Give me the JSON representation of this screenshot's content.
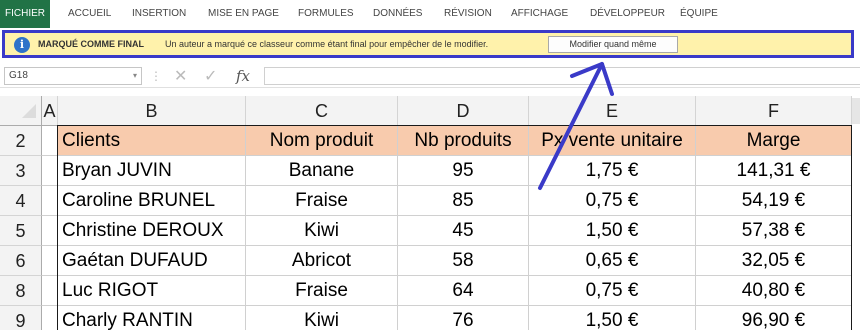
{
  "ribbon": {
    "tabs": [
      "FICHIER",
      "ACCUEIL",
      "INSERTION",
      "MISE EN PAGE",
      "FORMULES",
      "DONNÉES",
      "RÉVISION",
      "AFFICHAGE",
      "DÉVELOPPEUR",
      "ÉQUIPE"
    ]
  },
  "infobar": {
    "title": "MARQUÉ COMME FINAL",
    "message": "Un auteur a marqué ce classeur comme étant final pour empêcher de le modifier.",
    "button_label": "Modifier quand même",
    "icon": "info-icon"
  },
  "formula_bar": {
    "name_box": "G18",
    "fx_label": "fx",
    "formula": ""
  },
  "grid": {
    "columns": [
      "A",
      "B",
      "C",
      "D",
      "E",
      "F"
    ],
    "rows": [
      "2",
      "3",
      "4",
      "5",
      "6",
      "8",
      "9"
    ],
    "table": {
      "headers": [
        "Clients",
        "Nom produit",
        "Nb produits",
        "Px vente unitaire",
        "Marge"
      ],
      "rows": [
        [
          "Bryan JUVIN",
          "Banane",
          "95",
          "1,75 €",
          "141,31 €"
        ],
        [
          "Caroline BRUNEL",
          "Fraise",
          "85",
          "0,75 €",
          "54,19 €"
        ],
        [
          "Christine DEROUX",
          "Kiwi",
          "45",
          "1,50 €",
          "57,38 €"
        ],
        [
          "Gaétan DUFAUD",
          "Abricot",
          "58",
          "0,65 €",
          "32,05 €"
        ],
        [
          "Luc RIGOT",
          "Fraise",
          "64",
          "0,75 €",
          "40,80 €"
        ],
        [
          "Charly RANTIN",
          "Kiwi",
          "76",
          "1,50 €",
          "96,90 €"
        ]
      ]
    }
  },
  "colors": {
    "file_tab": "#217346",
    "infobar_bg": "#fff2ab",
    "highlight_frame": "#3a3ac8",
    "header_fill": "#f8cbad"
  }
}
